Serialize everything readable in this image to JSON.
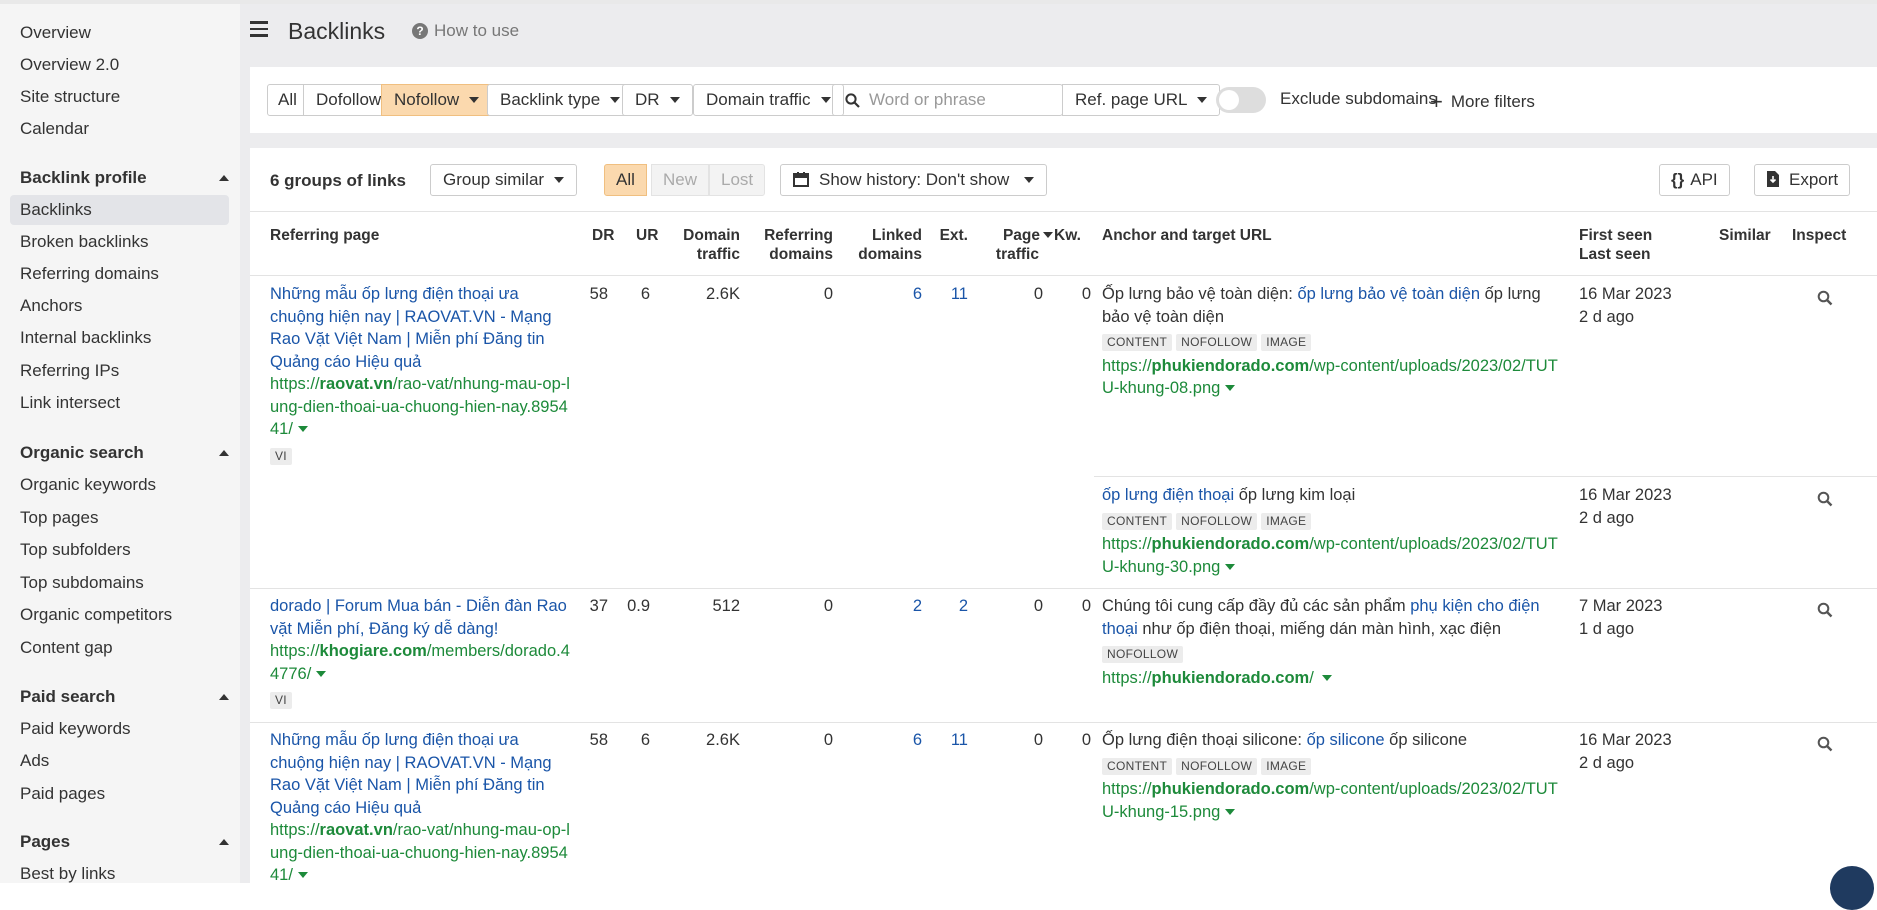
{
  "sidebar": {
    "top_items": [
      "Overview",
      "Overview 2.0",
      "Site structure",
      "Calendar"
    ],
    "sections": [
      {
        "title": "Backlink profile",
        "items": [
          "Backlinks",
          "Broken backlinks",
          "Referring domains",
          "Anchors",
          "Internal backlinks",
          "Referring IPs",
          "Link intersect"
        ]
      },
      {
        "title": "Organic search",
        "items": [
          "Organic keywords",
          "Top pages",
          "Top subfolders",
          "Top subdomains",
          "Organic competitors",
          "Content gap"
        ]
      },
      {
        "title": "Paid search",
        "items": [
          "Paid keywords",
          "Ads",
          "Paid pages"
        ]
      },
      {
        "title": "Pages",
        "items": [
          "Best by links"
        ]
      }
    ],
    "active_item": "Backlinks"
  },
  "header": {
    "title": "Backlinks",
    "how_to": "How to use"
  },
  "filters": {
    "link_types": [
      "All",
      "Dofollow",
      "Nofollow"
    ],
    "selected_type": "Nofollow",
    "backlink_type": "Backlink type",
    "dr": "DR",
    "domain_traffic": "Domain traffic",
    "search_placeholder": "Word or phrase",
    "ref_page_url": "Ref. page URL",
    "exclude_subdomains": "Exclude subdomains",
    "more_filters": "More filters"
  },
  "toolbar": {
    "groups_count": "6 groups of links",
    "group_similar": "Group similar",
    "tabs": [
      "All",
      "New",
      "Lost"
    ],
    "show_history": "Show history: Don't show",
    "api": "API",
    "export": "Export"
  },
  "columns": {
    "referring_page": "Referring page",
    "dr": "DR",
    "ur": "UR",
    "domain_traffic_1": "Domain",
    "domain_traffic_2": "traffic",
    "ref_domains_1": "Referring",
    "ref_domains_2": "domains",
    "linked_domains_1": "Linked",
    "linked_domains_2": "domains",
    "ext": "Ext.",
    "page_traffic_1": "Page",
    "page_traffic_2": "traffic",
    "kw": "Kw.",
    "anchor": "Anchor and target URL",
    "first_seen": "First seen",
    "last_seen": "Last seen",
    "similar": "Similar",
    "inspect": "Inspect"
  },
  "rows": [
    {
      "title": "Những mẫu ốp lưng điện thoại ưa chuộng hiện nay | RAOVAT.VN - Mạng Rao Vặt Việt Nam | Miễn phí Đăng tin Quảng cáo Hiệu quả",
      "url_prefix": "https://",
      "url_domain": "raovat.vn",
      "url_rest": "/rao-vat/nhung-mau-op-lung-dien-thoai-ua-chuong-hien-nay.895441/",
      "lang": "VI",
      "dr": "58",
      "ur": "6",
      "domain_traffic": "2.6K",
      "ref_domains": "0",
      "linked_domains": "6",
      "ext": "11",
      "page_traffic": "0",
      "kw": "0",
      "anchors": [
        {
          "before": "Ốp lưng bảo vệ toàn diện: ",
          "link": "ốp lưng bảo vệ toàn diện",
          "after": " ốp lưng bảo vệ toàn diện",
          "tags": [
            "CONTENT",
            "NOFOLLOW",
            "IMAGE"
          ],
          "target_prefix": "https://",
          "target_domain": "phukiendorado.com",
          "target_rest": "/wp-content/uploads/2023/02/TUTU-khung-08.png",
          "first_seen": "16 Mar 2023",
          "last_seen": "2 d ago"
        },
        {
          "before": "",
          "link": "ốp lưng điện thoại",
          "after": " ốp lưng kim loại",
          "tags": [
            "CONTENT",
            "NOFOLLOW",
            "IMAGE"
          ],
          "target_prefix": "https://",
          "target_domain": "phukiendorado.com",
          "target_rest": "/wp-content/uploads/2023/02/TUTU-khung-30.png",
          "first_seen": "16 Mar 2023",
          "last_seen": "2 d ago"
        }
      ]
    },
    {
      "title": "dorado | Forum Mua bán - Diễn đàn Rao vặt Miễn phí, Đăng ký dễ dàng!",
      "url_prefix": "https://",
      "url_domain": "khogiare.com",
      "url_rest": "/members/dorado.44776/",
      "lang": "VI",
      "dr": "37",
      "ur": "0.9",
      "domain_traffic": "512",
      "ref_domains": "0",
      "linked_domains": "2",
      "ext": "2",
      "page_traffic": "0",
      "kw": "0",
      "anchors": [
        {
          "before": "Chúng tôi cung cấp đầy đủ các sản phẩm ",
          "link": "phụ kiện cho điện thoại",
          "after": " như ốp điện thoại, miếng dán màn hình, xạc điện",
          "tags": [
            "NOFOLLOW"
          ],
          "target_prefix": "https://",
          "target_domain": "phukiendorado.com",
          "target_rest": "/",
          "first_seen": "7 Mar 2023",
          "last_seen": "1 d ago"
        }
      ]
    },
    {
      "title": "Những mẫu ốp lưng điện thoại ưa chuộng hiện nay | RAOVAT.VN - Mạng Rao Vặt Việt Nam | Miễn phí Đăng tin Quảng cáo Hiệu quả",
      "url_prefix": "https://",
      "url_domain": "raovat.vn",
      "url_rest": "/rao-vat/nhung-mau-op-lung-dien-thoai-ua-chuong-hien-nay.895441/",
      "dr": "58",
      "ur": "6",
      "domain_traffic": "2.6K",
      "ref_domains": "0",
      "linked_domains": "6",
      "ext": "11",
      "page_traffic": "0",
      "kw": "0",
      "anchors": [
        {
          "before": "Ốp lưng điện thoại silicone: ",
          "link": "ốp silicone",
          "after": " ốp silicone",
          "tags": [
            "CONTENT",
            "NOFOLLOW",
            "IMAGE"
          ],
          "target_prefix": "https://",
          "target_domain": "phukiendorado.com",
          "target_rest": "/wp-content/uploads/2023/02/TUTU-khung-15.png",
          "first_seen": "16 Mar 2023",
          "last_seen": "2 d ago"
        }
      ]
    }
  ]
}
